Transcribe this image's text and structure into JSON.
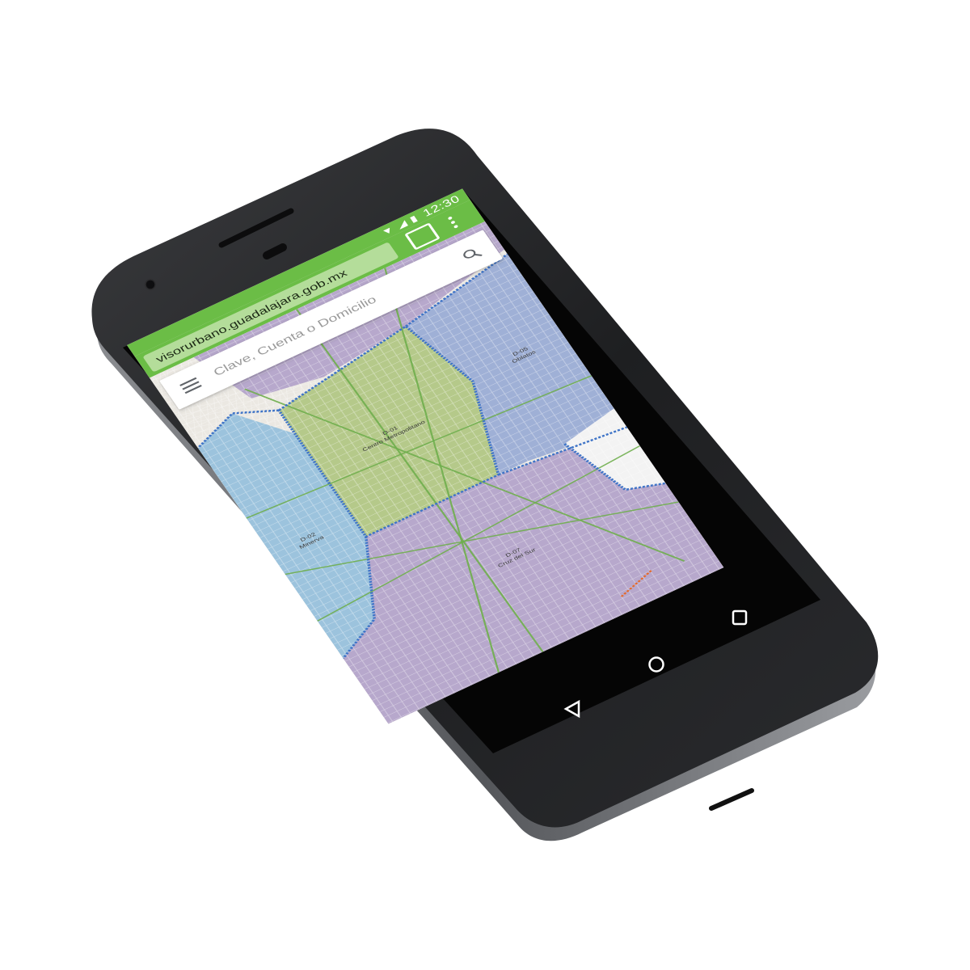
{
  "device": {
    "type": "android-phone",
    "body_color": "#1f1f21"
  },
  "status_bar": {
    "icons": [
      "wifi-icon",
      "signal-icon",
      "battery-icon"
    ],
    "time": "12:30",
    "color": "#6bbd46"
  },
  "browser": {
    "url": "visorurbano.guadalajara.gob.mx",
    "tabs_icon": "tabs-square-icon",
    "menu_icon": "overflow-menu-icon",
    "accent": "#6bbd46"
  },
  "search": {
    "placeholder": "Clave, Cuenta o Domicilio",
    "menu_icon": "hamburger-icon",
    "search_icon": "search-icon"
  },
  "map": {
    "districts": [
      {
        "label": "D-01",
        "name": "Centro Metropolitano",
        "color": "#b5c98a"
      },
      {
        "label": "D-05",
        "name": "Oblatos",
        "color": "#9fb0d6"
      },
      {
        "label": "D-07",
        "name": "Cruz del Sur",
        "color": "#b7a8cc"
      },
      {
        "label": "D-02",
        "name": "Minerva",
        "color": "#9cc3dd"
      }
    ],
    "boundary_color": "#3f74c7"
  },
  "nav_bar": {
    "buttons": [
      "back-icon",
      "home-icon",
      "recents-icon"
    ]
  }
}
